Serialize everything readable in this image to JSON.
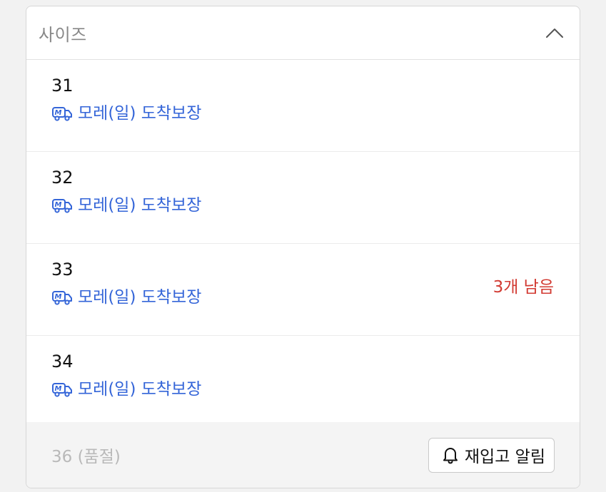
{
  "accordion": {
    "title": "사이즈",
    "expanded_icon": "chevron-up-icon"
  },
  "colors": {
    "delivery_text": "#3465d8",
    "stock_warning": "#d23a32",
    "soldout_text": "#b9b9b9"
  },
  "options": [
    {
      "size": "31",
      "delivery_icon": "truck-icon",
      "delivery": "모레(일) 도착보장",
      "stock_note": ""
    },
    {
      "size": "32",
      "delivery_icon": "truck-icon",
      "delivery": "모레(일) 도착보장",
      "stock_note": ""
    },
    {
      "size": "33",
      "delivery_icon": "truck-icon",
      "delivery": "모레(일) 도착보장",
      "stock_note": "3개 남음"
    },
    {
      "size": "34",
      "delivery_icon": "truck-icon",
      "delivery": "모레(일) 도착보장",
      "stock_note": ""
    }
  ],
  "soldout_option": {
    "label": "36 (품절)",
    "restock_button": "재입고 알림",
    "button_icon": "bell-icon"
  }
}
